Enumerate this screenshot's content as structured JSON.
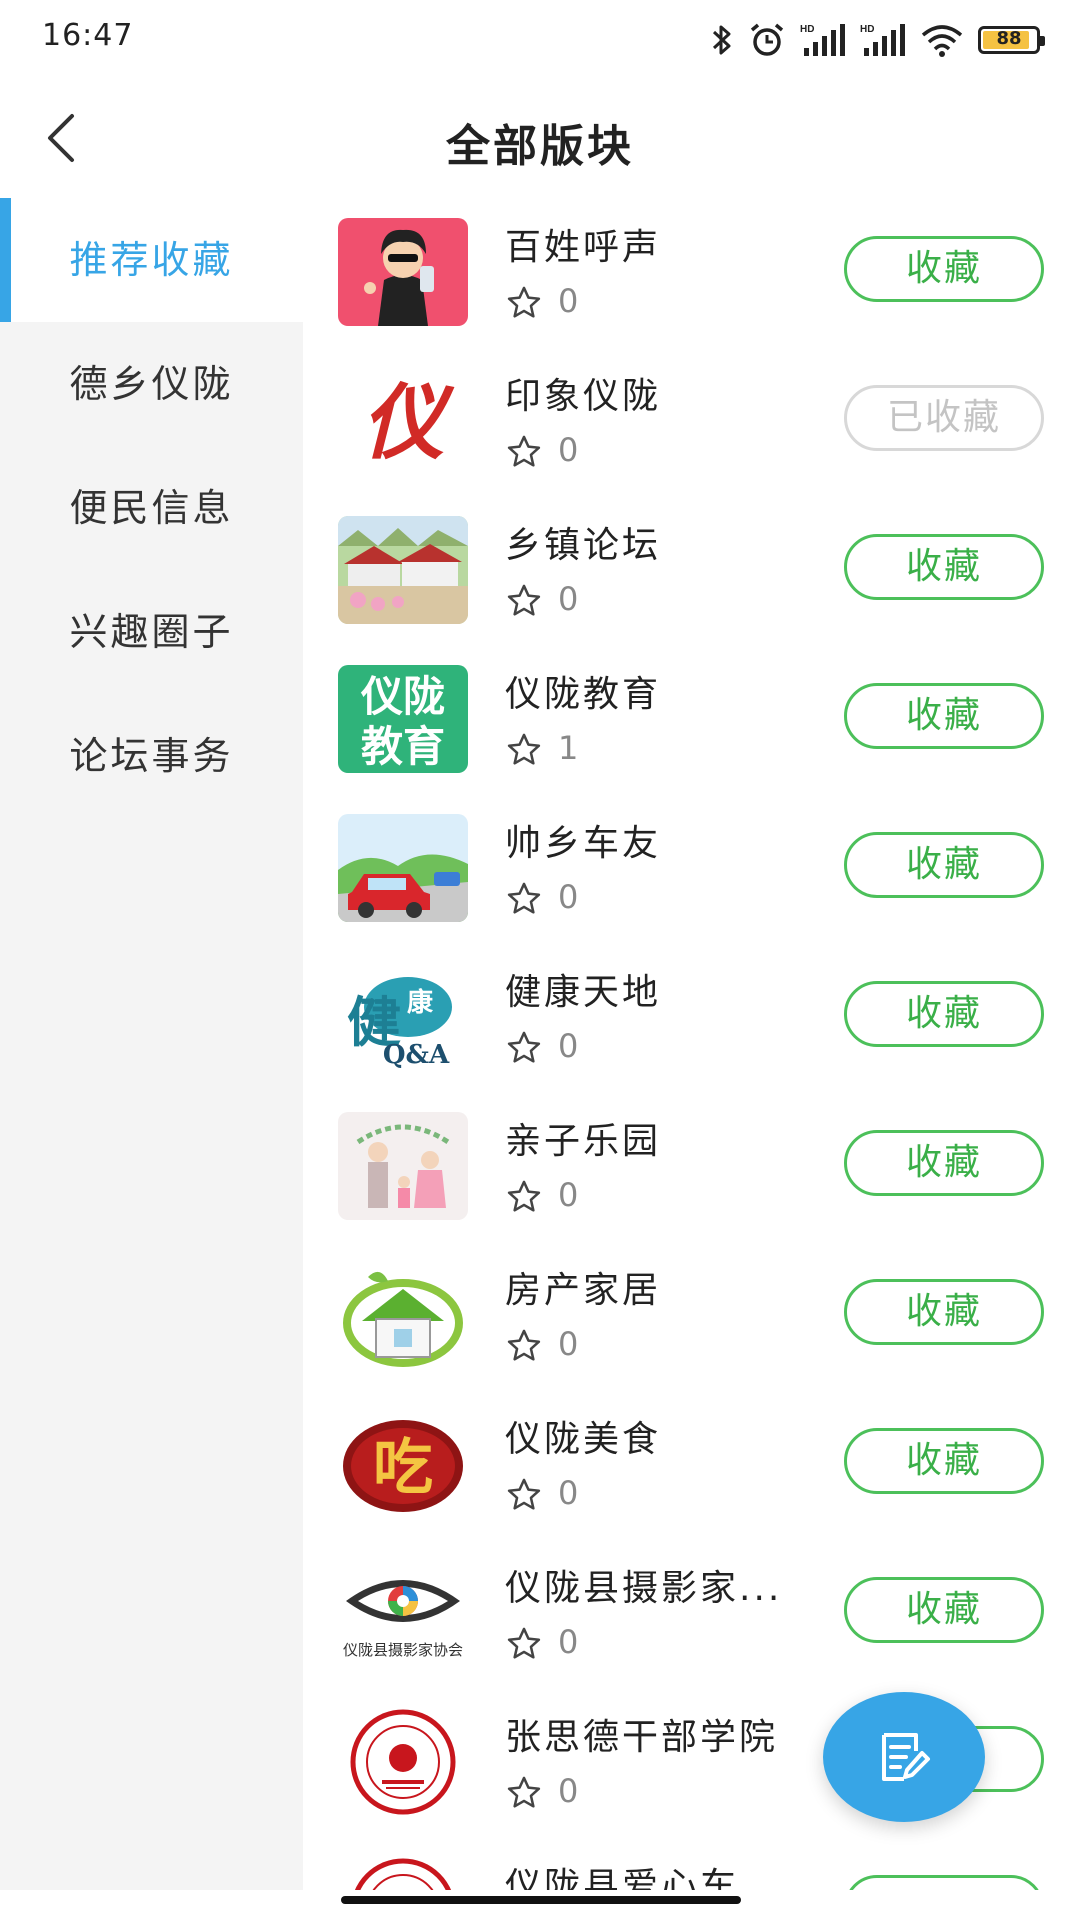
{
  "status_bar": {
    "time": "16:47",
    "battery": "88"
  },
  "header": {
    "title": "全部版块"
  },
  "sidebar": {
    "items": [
      {
        "label": "推荐收藏",
        "active": true
      },
      {
        "label": "德乡仪陇",
        "active": false
      },
      {
        "label": "便民信息",
        "active": false
      },
      {
        "label": "兴趣圈子",
        "active": false
      },
      {
        "label": "论坛事务",
        "active": false
      }
    ]
  },
  "forums": [
    {
      "title": "百姓呼声",
      "count": "0",
      "button": "收藏",
      "favorited": false,
      "icon": "cartoon-man-thumb"
    },
    {
      "title": "印象仪陇",
      "count": "0",
      "button": "已收藏",
      "favorited": true,
      "icon": "red-calligraphy-yi-thumb"
    },
    {
      "title": "乡镇论坛",
      "count": "0",
      "button": "收藏",
      "favorited": false,
      "icon": "village-houses-thumb"
    },
    {
      "title": "仪陇教育",
      "count": "1",
      "button": "收藏",
      "favorited": false,
      "icon": "green-education-thumb"
    },
    {
      "title": "帅乡车友",
      "count": "0",
      "button": "收藏",
      "favorited": false,
      "icon": "red-car-thumb"
    },
    {
      "title": "健康天地",
      "count": "0",
      "button": "收藏",
      "favorited": false,
      "icon": "health-qa-thumb"
    },
    {
      "title": "亲子乐园",
      "count": "0",
      "button": "收藏",
      "favorited": false,
      "icon": "family-thumb"
    },
    {
      "title": "房产家居",
      "count": "0",
      "button": "收藏",
      "favorited": false,
      "icon": "green-house-thumb"
    },
    {
      "title": "仪陇美食",
      "count": "0",
      "button": "收藏",
      "favorited": false,
      "icon": "food-chi-thumb"
    },
    {
      "title": "仪陇县摄影家...",
      "count": "0",
      "button": "收藏",
      "favorited": false,
      "icon": "photography-association-thumb"
    },
    {
      "title": "张思德干部学院",
      "count": "0",
      "button": "收藏",
      "favorited": false,
      "icon": "college-seal-thumb"
    },
    {
      "title": "仪陇县爱心车...",
      "count": "",
      "button": "",
      "favorited": false,
      "icon": "charity-seal-thumb"
    }
  ],
  "thumb_texts": {
    "yi": "仪",
    "edu1": "仪陇",
    "edu2": "教育",
    "health": "健",
    "health_small": "康",
    "qa": "Q&A",
    "chi": "吃",
    "photo_caption": "仪陇县摄影家协会"
  },
  "colors": {
    "accent_blue": "#37a5e6",
    "button_green": "#4cc05a",
    "favorited_gray": "#d8d8d8",
    "sidebar_bg": "#f4f4f4"
  }
}
